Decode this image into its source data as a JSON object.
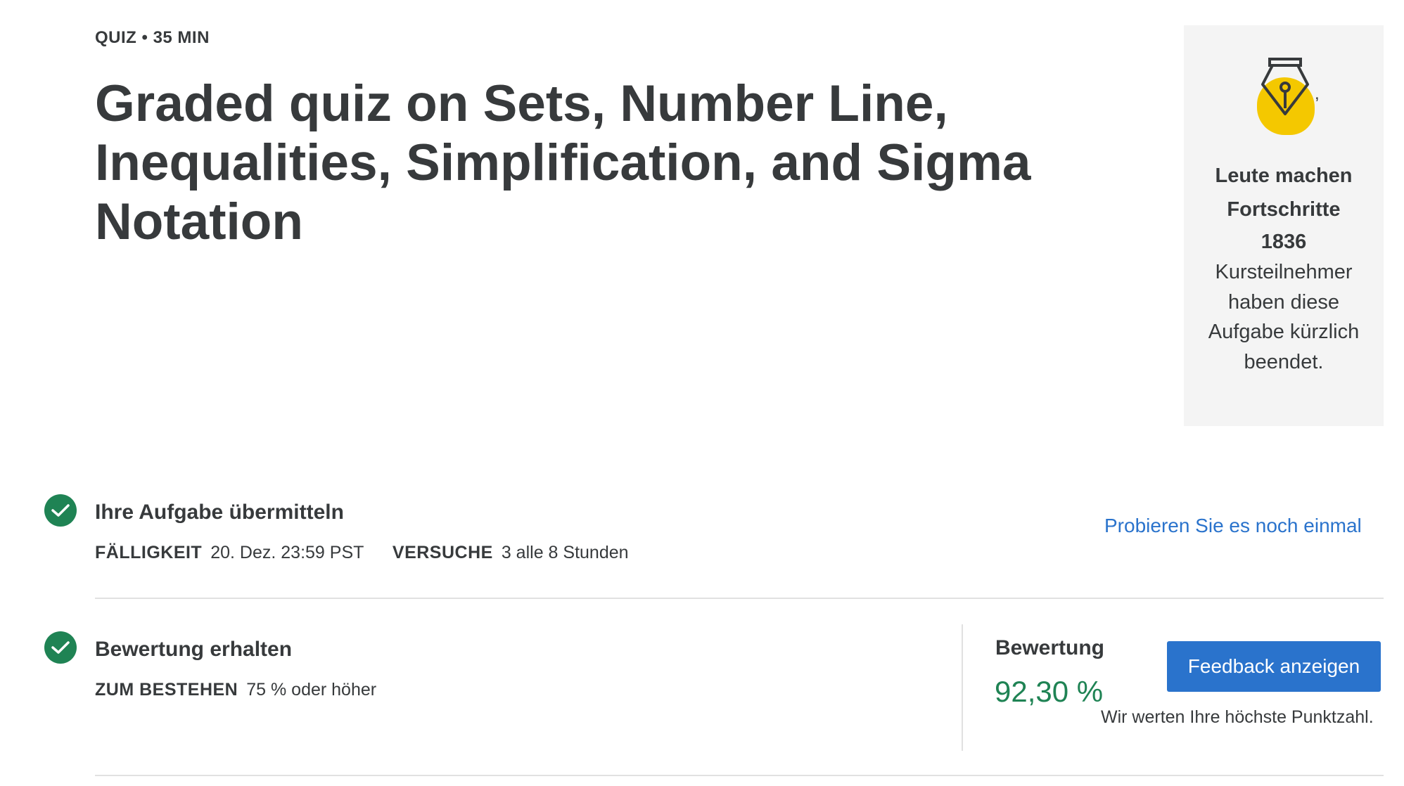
{
  "header": {
    "meta": "QUIZ • 35 MIN",
    "title": "Graded quiz on Sets, Number Line, Inequalities, Simplification, and Sigma Notation"
  },
  "side_card": {
    "icon": "fountain-pen-icon",
    "accent_color": "#f4c800",
    "comma": ",",
    "headline_line1": "Leute machen",
    "headline_line2": "Fortschritte",
    "count": "1836",
    "description": "Kursteilnehmer haben diese Aufgabe kürzlich beendet."
  },
  "submit_step": {
    "title": "Ihre Aufgabe übermitteln",
    "due_label": "FÄLLIGKEIT",
    "due_value": "20. Dez. 23:59 PST",
    "attempts_label": "VERSUCHE",
    "attempts_value": "3 alle 8 Stunden",
    "retry_link": "Probieren Sie es noch einmal"
  },
  "grade_step": {
    "title": "Bewertung erhalten",
    "pass_label": "ZUM BESTEHEN",
    "pass_value": "75 % oder höher",
    "grade_label": "Bewertung",
    "grade_value": "92,30 %",
    "feedback_button": "Feedback anzeigen",
    "note": "Wir werten Ihre höchste Punktzahl."
  },
  "colors": {
    "success": "#1f8354",
    "primary": "#2a73cc",
    "text": "#373a3c"
  }
}
